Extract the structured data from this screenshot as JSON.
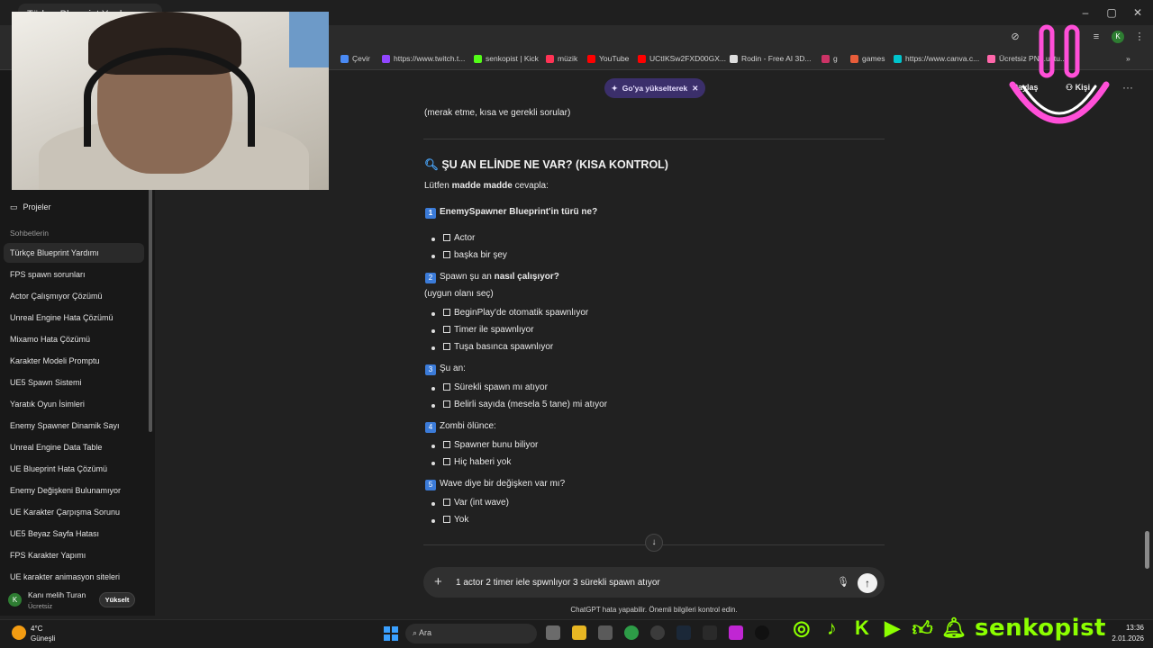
{
  "browser": {
    "tab_title": "Türkçe Blueprint Yardımı",
    "bookmarks": [
      {
        "label": "Çevir",
        "color": "#4a8af4"
      },
      {
        "label": "https://www.twitch.t...",
        "color": "#9146ff"
      },
      {
        "label": "senkopist | Kick",
        "color": "#53fc18"
      },
      {
        "label": "müzik",
        "color": "#ff3355"
      },
      {
        "label": "YouTube",
        "color": "#ff0000"
      },
      {
        "label": "UCtIKSw2FXD00GX...",
        "color": "#ff0000"
      },
      {
        "label": "Rodin - Free AI 3D...",
        "color": "#dddddd"
      },
      {
        "label": "g",
        "color": "#cc3366"
      },
      {
        "label": "games",
        "color": "#e85d3a"
      },
      {
        "label": "https://www.canva.c...",
        "color": "#00c4cc"
      },
      {
        "label": "Ücretsiz PN...uştu...",
        "color": "#ff66aa"
      }
    ],
    "profile_initial": "K"
  },
  "sidebar": {
    "projects_label": "Projeler",
    "section_label": "Sohbetlerin",
    "chats": [
      "Türkçe Blueprint Yardımı",
      "FPS spawn sorunları",
      "Actor Çalışmıyor Çözümü",
      "Unreal Engine Hata Çözümü",
      "Mixamo Hata Çözümü",
      "Karakter Modeli Promptu",
      "UE5 Spawn Sistemi",
      "Yaratık Oyun İsimleri",
      "Enemy Spawner Dinamik Sayı",
      "Unreal Engine Data Table",
      "UE Blueprint Hata Çözümü",
      "Enemy Değişkeni Bulunamıyor",
      "UE Karakter Çarpışma Sorunu",
      "UE5 Beyaz Sayfa Hatası",
      "FPS Karakter Yapımı",
      "UE karakter animasyon siteleri"
    ],
    "active_index": 0,
    "user": {
      "initial": "K",
      "name": "Kanı melih Turan",
      "plan": "Ücretsiz",
      "upgrade_label": "Yükselt"
    }
  },
  "header": {
    "upgrade_pill": "Go'ya yükselterek",
    "share_label": "Paylaş",
    "person_label": "Kişi"
  },
  "message": {
    "intro_line": "(merak etme, kısa ve gerekli sorular)",
    "heading": "ŞU AN ELİNDE NE VAR? (KISA KONTROL)",
    "prompt_pre": "Lütfen ",
    "prompt_bold": "madde madde",
    "prompt_post": " cevapla:",
    "q1_num": "1",
    "q1": "EnemySpawner Blueprint'in türü ne?",
    "q1_options": [
      "Actor",
      "başka bir şey"
    ],
    "q2_num": "2",
    "q2_pre": "Spawn şu an ",
    "q2_bold": "nasıl çalışıyor?",
    "q2_hint": "(uygun olanı seç)",
    "q2_options": [
      "BeginPlay'de otomatik spawnlıyor",
      "Timer ile spawnlıyor",
      "Tuşa basınca spawnlıyor"
    ],
    "q3_num": "3",
    "q3": "Şu an:",
    "q3_options": [
      "Sürekli spawn mı atıyor",
      "Belirli sayıda (mesela 5 tane) mi atıyor"
    ],
    "q4_num": "4",
    "q4": "Zombi ölünce:",
    "q4_options": [
      "Spawner bunu biliyor",
      "Hiç haberi yok"
    ],
    "q5_num": "5",
    "q5": "Wave diye bir değişken var mı?",
    "q5_options": [
      "Var (int wave)",
      "Yok"
    ]
  },
  "composer": {
    "input_value": "1 actor 2 timer iele spwnlıyor 3 sürekli spawn atıyor",
    "disclaimer": "ChatGPT hata yapabilir. Önemli bilgileri kontrol edin."
  },
  "taskbar": {
    "temperature": "4°C",
    "weather": "Güneşli",
    "search_placeholder": "Ara",
    "time": "13:36",
    "date": "2.01.2026"
  },
  "overlay": {
    "social_name": "senkopist",
    "accent_color": "#8cff00"
  }
}
